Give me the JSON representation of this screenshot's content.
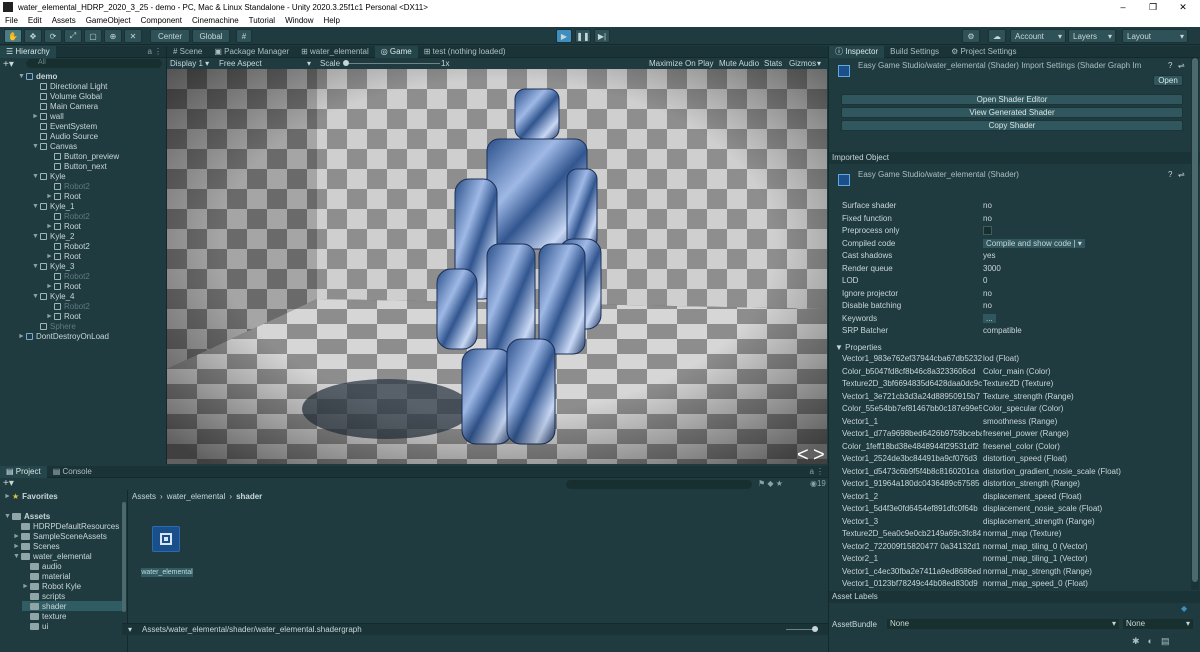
{
  "window": {
    "title": "water_elemental_HDRP_2020_3_25 - demo - PC, Mac & Linux Standalone - Unity 2020.3.25f1c1 Personal <DX11>",
    "minimize": "–",
    "maximize": "❐",
    "close": "✕"
  },
  "menu": [
    "File",
    "Edit",
    "Assets",
    "GameObject",
    "Component",
    "Cinemachine",
    "Tutorial",
    "Window",
    "Help"
  ],
  "toolbar": {
    "pivot": "Center",
    "space": "Global",
    "account": "Account",
    "layers": "Layers",
    "layout": "Layout"
  },
  "hierarchy": {
    "tab": "Hierarchy",
    "search_placeholder": "All",
    "items": [
      {
        "label": "demo",
        "depth": 0,
        "arrow": "▼",
        "icon": "scene",
        "dim": false
      },
      {
        "label": "Directional Light",
        "depth": 1,
        "arrow": "",
        "icon": "cube",
        "dim": false
      },
      {
        "label": "Volume Global",
        "depth": 1,
        "arrow": "",
        "icon": "cube",
        "dim": false
      },
      {
        "label": "Main Camera",
        "depth": 1,
        "arrow": "",
        "icon": "cube",
        "dim": false
      },
      {
        "label": "wall",
        "depth": 1,
        "arrow": "►",
        "icon": "cube",
        "dim": false
      },
      {
        "label": "EventSystem",
        "depth": 1,
        "arrow": "",
        "icon": "cube",
        "dim": false
      },
      {
        "label": "Audio Source",
        "depth": 1,
        "arrow": "",
        "icon": "cube",
        "dim": false
      },
      {
        "label": "Canvas",
        "depth": 1,
        "arrow": "▼",
        "icon": "cube",
        "dim": false
      },
      {
        "label": "Button_preview",
        "depth": 2,
        "arrow": "",
        "icon": "cube",
        "dim": false
      },
      {
        "label": "Button_next",
        "depth": 2,
        "arrow": "",
        "icon": "cube",
        "dim": false
      },
      {
        "label": "Kyle",
        "depth": 1,
        "arrow": "▼",
        "icon": "cube",
        "dim": false
      },
      {
        "label": "Robot2",
        "depth": 2,
        "arrow": "",
        "icon": "cube",
        "dim": true
      },
      {
        "label": "Root",
        "depth": 2,
        "arrow": "►",
        "icon": "cube",
        "dim": false
      },
      {
        "label": "Kyle_1",
        "depth": 1,
        "arrow": "▼",
        "icon": "cube",
        "dim": false
      },
      {
        "label": "Robot2",
        "depth": 2,
        "arrow": "",
        "icon": "cube",
        "dim": true
      },
      {
        "label": "Root",
        "depth": 2,
        "arrow": "►",
        "icon": "cube",
        "dim": false
      },
      {
        "label": "Kyle_2",
        "depth": 1,
        "arrow": "▼",
        "icon": "cube",
        "dim": false
      },
      {
        "label": "Robot2",
        "depth": 2,
        "arrow": "",
        "icon": "cube",
        "dim": false
      },
      {
        "label": "Root",
        "depth": 2,
        "arrow": "►",
        "icon": "cube",
        "dim": false
      },
      {
        "label": "Kyle_3",
        "depth": 1,
        "arrow": "▼",
        "icon": "cube",
        "dim": false
      },
      {
        "label": "Robot2",
        "depth": 2,
        "arrow": "",
        "icon": "cube",
        "dim": true
      },
      {
        "label": "Root",
        "depth": 2,
        "arrow": "►",
        "icon": "cube",
        "dim": false
      },
      {
        "label": "Kyle_4",
        "depth": 1,
        "arrow": "▼",
        "icon": "cube",
        "dim": false
      },
      {
        "label": "Robot2",
        "depth": 2,
        "arrow": "",
        "icon": "cube",
        "dim": true
      },
      {
        "label": "Root",
        "depth": 2,
        "arrow": "►",
        "icon": "cube",
        "dim": false
      },
      {
        "label": "Sphere",
        "depth": 1,
        "arrow": "",
        "icon": "cube",
        "dim": true
      },
      {
        "label": "DontDestroyOnLoad",
        "depth": 0,
        "arrow": "►",
        "icon": "scene",
        "dim": false
      }
    ]
  },
  "center_tabs": [
    "Scene",
    "Package Manager",
    "water_elemental",
    "Game",
    "test (nothing loaded)"
  ],
  "game_bar": {
    "display": "Display 1",
    "aspect": "Free Aspect",
    "scale_label": "Scale",
    "scale_value": "1x",
    "maximize": "Maximize On Play",
    "mute": "Mute Audio",
    "stats": "Stats",
    "gizmos": "Gizmos"
  },
  "game_nav": {
    "prev": "<",
    "next": ">"
  },
  "project": {
    "tabs": [
      "Project",
      "Console"
    ],
    "favorites": "Favorites",
    "tree": [
      {
        "label": "Assets",
        "depth": 0,
        "arrow": "▼",
        "selected": false,
        "bold": true
      },
      {
        "label": "HDRPDefaultResources",
        "depth": 1,
        "arrow": "",
        "selected": false,
        "bold": false
      },
      {
        "label": "SampleSceneAssets",
        "depth": 1,
        "arrow": "►",
        "selected": false,
        "bold": false
      },
      {
        "label": "Scenes",
        "depth": 1,
        "arrow": "►",
        "selected": false,
        "bold": false
      },
      {
        "label": "water_elemental",
        "depth": 1,
        "arrow": "▼",
        "selected": false,
        "bold": false
      },
      {
        "label": "audio",
        "depth": 2,
        "arrow": "",
        "selected": false,
        "bold": false
      },
      {
        "label": "material",
        "depth": 2,
        "arrow": "",
        "selected": false,
        "bold": false
      },
      {
        "label": "Robot Kyle",
        "depth": 2,
        "arrow": "►",
        "selected": false,
        "bold": false
      },
      {
        "label": "scripts",
        "depth": 2,
        "arrow": "",
        "selected": false,
        "bold": false
      },
      {
        "label": "shader",
        "depth": 2,
        "arrow": "",
        "selected": true,
        "bold": false
      },
      {
        "label": "texture",
        "depth": 2,
        "arrow": "",
        "selected": false,
        "bold": false
      },
      {
        "label": "ui",
        "depth": 2,
        "arrow": "",
        "selected": false,
        "bold": false
      }
    ],
    "breadcrumb": [
      "Assets",
      "water_elemental",
      "shader"
    ],
    "asset_name": "water_elemental",
    "asset_path": "Assets/water_elemental/shader/water_elemental.shadergraph",
    "count": "19"
  },
  "inspector": {
    "tabs": [
      "Inspector",
      "Build Settings",
      "Project Settings"
    ],
    "title": "Easy Game Studio/water_elemental (Shader) Import Settings (Shader Graph Im",
    "open_label": "Open",
    "buttons": [
      "Open Shader Editor",
      "View Generated Shader",
      "Copy Shader"
    ],
    "imported_object": "Imported Object",
    "sub_title": "Easy Game Studio/water_elemental (Shader)",
    "fields": [
      {
        "k": "Surface shader",
        "v": "no"
      },
      {
        "k": "Fixed function",
        "v": "no"
      },
      {
        "k": "Preprocess only",
        "v": ""
      },
      {
        "k": "Compiled code",
        "v": "Compile and show code | ▾"
      },
      {
        "k": "Cast shadows",
        "v": "yes"
      },
      {
        "k": "Render queue",
        "v": "3000"
      },
      {
        "k": "LOD",
        "v": "0"
      },
      {
        "k": "Ignore projector",
        "v": "no"
      },
      {
        "k": "Disable batching",
        "v": "no"
      },
      {
        "k": "Keywords",
        "v": "..."
      },
      {
        "k": "SRP Batcher",
        "v": "compatible"
      }
    ],
    "properties_label": "Properties",
    "properties": [
      {
        "k": "Vector1_983e762ef37944cba67db5232",
        "v": "lod (Float)"
      },
      {
        "k": "Color_b5047fd8cf8b46c8a3233606cd",
        "v": "Color_main (Color)"
      },
      {
        "k": "Texture2D_3bf6694835d6428daa0dc9c",
        "v": "Texture2D (Texture)"
      },
      {
        "k": "Vector1_3e721cb3d3a24d88950915b7",
        "v": "Texture_strength (Range)"
      },
      {
        "k": "Color_55e54bb7ef81467bb0c187e99e5",
        "v": "Color_specular (Color)"
      },
      {
        "k": "Vector1_1",
        "v": "smoothness (Range)"
      },
      {
        "k": "Vector1_d77a9698bed6426b9759bceba",
        "v": "fresenel_power (Range)"
      },
      {
        "k": "Color_1feff18bd38e4848944f29531df2",
        "v": "fresenel_color (Color)"
      },
      {
        "k": "Vector1_2524de3bc84491ba9cf076d3",
        "v": "distortion_speed (Float)"
      },
      {
        "k": "Vector1_d5473c6b9f5f4b8c8160201ca",
        "v": "distortion_gradient_nosie_scale (Float)"
      },
      {
        "k": "Vector1_91964a180dc0436489c67585",
        "v": "distortion_strength (Range)"
      },
      {
        "k": "Vector1_2",
        "v": "displacement_speed (Float)"
      },
      {
        "k": "Vector1_5d4f3e0fd6454ef891dfc0f64b",
        "v": "displacement_nosie_scale (Float)"
      },
      {
        "k": "Vector1_3",
        "v": "displacement_strength (Range)"
      },
      {
        "k": "Texture2D_5ea0c9e0cb2149a69c3fc84",
        "v": "normal_map (Texture)"
      },
      {
        "k": "Vector2_722009f15820477 0a34132d1",
        "v": "normal_map_tiling_0 (Vector)"
      },
      {
        "k": "Vector2_1",
        "v": "normal_map_tiling_1 (Vector)"
      },
      {
        "k": "Vector1_c4ec30fba2e7411a9ed8686ed",
        "v": "normal_map_strength (Range)"
      },
      {
        "k": "Vector1_0123bf78249c44b08ed830d9",
        "v": "normal_map_speed_0 (Float)"
      }
    ],
    "asset_labels": "Asset Labels",
    "assetbundle_label": "AssetBundle",
    "assetbundle_value": "None",
    "assetbundle_variant": "None"
  },
  "colors": {
    "bg": "#1f3b40",
    "accent": "#3c8fbf"
  }
}
